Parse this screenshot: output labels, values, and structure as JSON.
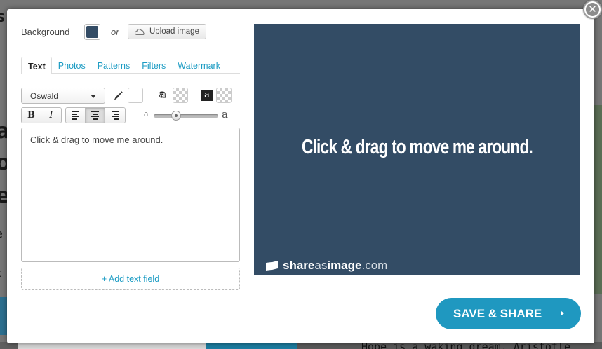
{
  "background_page": {
    "bottom_quote": "Hope is a waking dream. Aristotle"
  },
  "editor": {
    "background_label": "Background",
    "or_label": "or",
    "upload_label": "Upload image",
    "tabs": [
      {
        "label": "Text",
        "active": true
      },
      {
        "label": "Photos",
        "active": false
      },
      {
        "label": "Patterns",
        "active": false
      },
      {
        "label": "Filters",
        "active": false
      },
      {
        "label": "Watermark",
        "active": false
      }
    ],
    "font_select": "Oswald",
    "slider_min_label": "a",
    "slider_max_label": "a",
    "text_value": "Click & drag to move me around.",
    "add_text_field_label": "+ Add text field",
    "bold_label": "B",
    "italic_label": "I",
    "outline_glyph": "a",
    "box_glyph": "a"
  },
  "preview": {
    "text": "Click & drag to move me around.",
    "brand_share": "share",
    "brand_as": "as",
    "brand_image": "image",
    "brand_com": ".com"
  },
  "save_button": "SAVE & SHARE",
  "colors": {
    "background_color": "#334c65",
    "accent": "#1f98c0"
  },
  "icons": [
    "close-icon",
    "cloud-upload-icon",
    "dropper-icon",
    "align-left-icon",
    "align-center-icon",
    "align-right-icon",
    "book-icon",
    "chevron-right-icon"
  ]
}
